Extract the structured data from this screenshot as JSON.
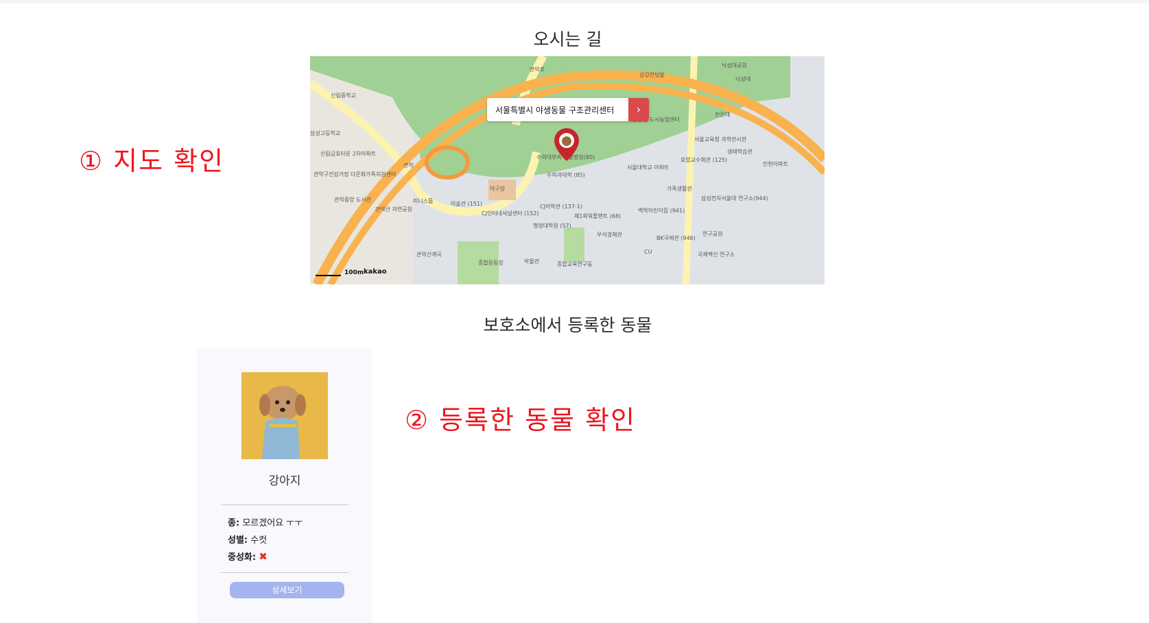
{
  "location": {
    "title": "오시는 길",
    "map": {
      "popup_label": "서울특별시 야생동물 구조관리센터",
      "scale_label": "100m",
      "provider": "kakao",
      "place_labels": [
        "관악로",
        "강감찬텃밭",
        "낙성대공원",
        "낙성대",
        "신림중학교",
        "삼성고등학교",
        "신림금호타운 2차아파트",
        "관악구건강가정 다문화가족지원센터",
        "관악중앙 도서관",
        "관악산 자연공원",
        "미니스톱",
        "관악",
        "강감찬 도시농업센터",
        "전문대",
        "서울교육청 과학전시관",
        "생태학습관",
        "인헌아파트",
        "서울대학교 아파트",
        "호암교수회관 (125)",
        "수의과대학 (85)",
        "야구장",
        "미술관 (151)",
        "CJ인터내셔널센터 (152)",
        "CJ어학관 (137-1)",
        "제1파워플랜트 (68)",
        "행정대학원 (57)",
        "우석경제관",
        "가족생활관",
        "삼성전자서울대 연구소(944)",
        "백학어린이집 (941)",
        "BK국제관 (946)",
        "연구공원",
        "국제백신 연구소",
        "CU",
        "관악산계곡",
        "종합운동장",
        "박물관",
        "종합교육연구동",
        "수의대부속 동물병원(80)"
      ],
      "colors": {
        "park": "#a0d094",
        "road": "#f9b24e",
        "campus": "#dfe3e8",
        "marker": "#c8242b",
        "popup_arrow": "#d94a4a"
      }
    }
  },
  "annotations": {
    "map_check": "① 지도 확인",
    "animal_check": "② 등록한 동물 확인"
  },
  "animals": {
    "title": "보호소에서 등록한 동물",
    "items": [
      {
        "name": "강아지",
        "species_label": "종:",
        "species": "모르겠어요 ㅜㅜ",
        "sex_label": "성별:",
        "sex": "수컷",
        "neutered_label": "중성화:",
        "neutered": false,
        "neutered_icon": "red-x-icon",
        "detail_button": "상세보기"
      }
    ]
  }
}
